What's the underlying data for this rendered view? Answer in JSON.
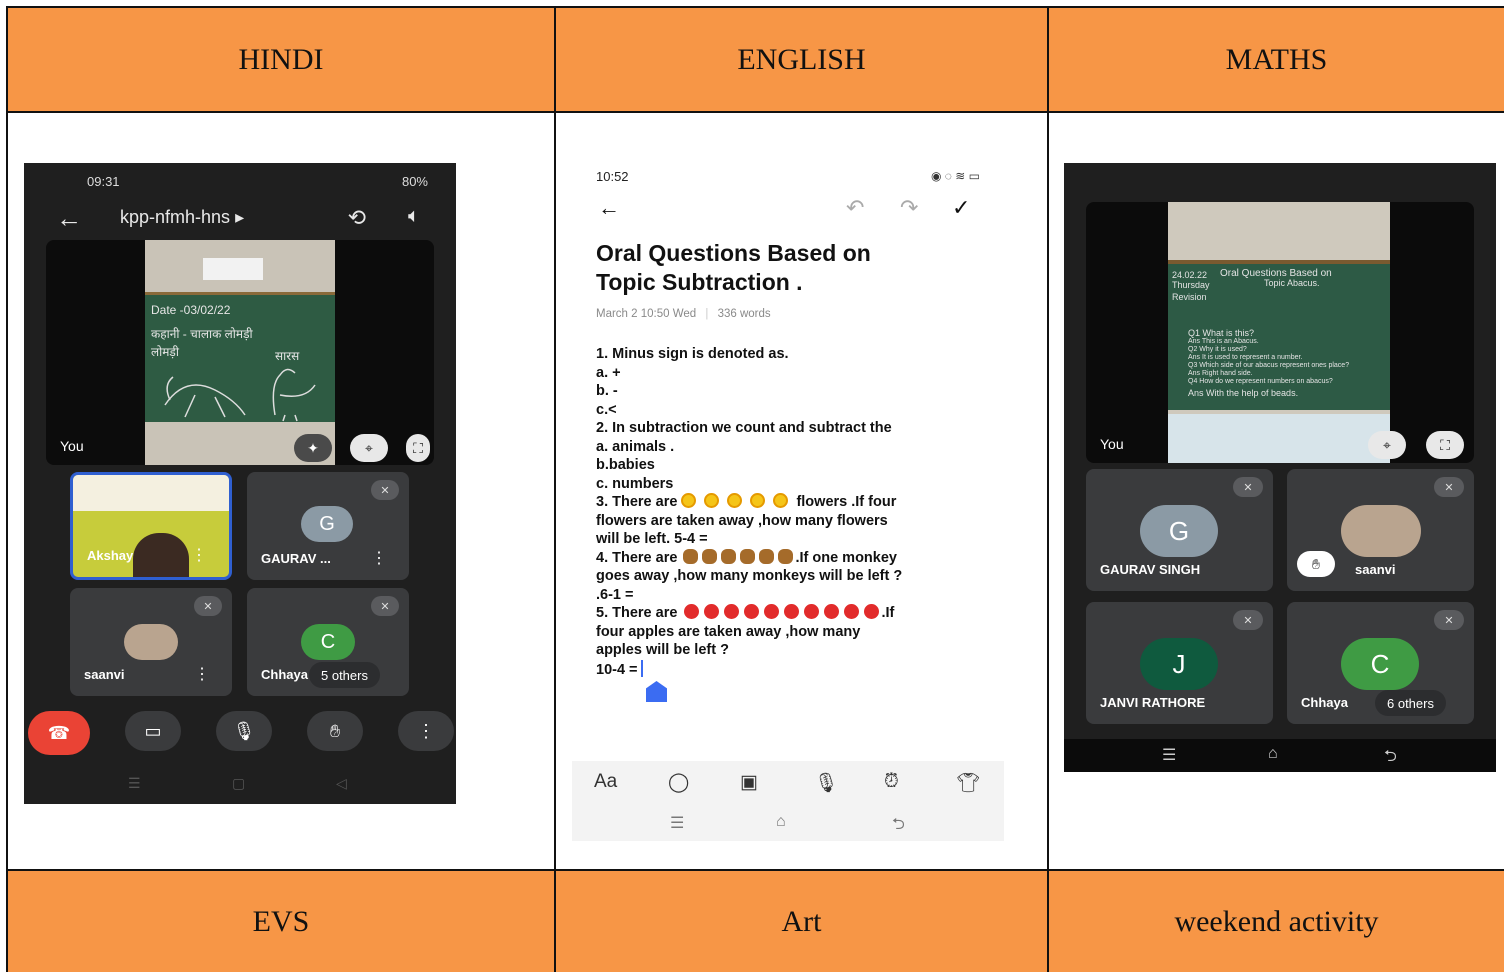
{
  "headers": [
    "HINDI",
    "ENGLISH",
    "MATHS"
  ],
  "footers": [
    "EVS",
    "Art",
    "weekend activity"
  ],
  "hindi_screen": {
    "time": "09:31",
    "status_right": "80%",
    "meeting_code": "kpp-nfmh-hns",
    "main_label": "You",
    "board_lines": [
      "Date -03/02/22",
      "कहानी - चालाक लोमड़ी",
      "लोमड़ी",
      "सारस"
    ],
    "tiles": [
      {
        "name": "Akshay",
        "avatar": ""
      },
      {
        "name": "GAURAV ...",
        "avatar": "G"
      },
      {
        "name": "saanvi",
        "avatar": ""
      },
      {
        "name": "Chhaya",
        "avatar": "C"
      }
    ],
    "others": "5 others"
  },
  "english_screen": {
    "status_left": "10:52",
    "title_line1": "Oral Questions Based on",
    "title_line2": "Topic Subtraction .",
    "date": "March 2 10:50 Wed",
    "word_count": "336 words",
    "lines": [
      "1. Minus sign is denoted as.",
      "a. +",
      "b. -",
      "c.<",
      "2. In subtraction we count and subtract the",
      "a. animals .",
      "b.babies",
      "c. numbers"
    ],
    "q3a": "3. There are",
    "q3b": "flowers .If four",
    "q3c": "flowers are taken away ,how many flowers",
    "q3d": "will be left. 5-4 =",
    "q4a": "4. There are",
    "q4b": ".If one monkey",
    "q4c": "goes away ,how many monkeys will be left ?",
    "q4d": ".6-1 =",
    "q5a": "5. There are",
    "q5b": ".If",
    "q5c": "four apples are taken away ,how many",
    "q5d": "apples will be left ?",
    "q5e": "10-4 =",
    "tool_text": "Aa"
  },
  "maths_screen": {
    "main_label": "You",
    "board_lines": [
      "24.02.22",
      "Oral Questions Based on",
      "Topic Abacus.",
      "Thursday",
      "Revision",
      "Q1 What is this?",
      "Ans This is an Abacus.",
      "Q2 Why it is used?",
      "Ans It is used to represent a number.",
      "Q3 Which side of our abacus represent ones place?",
      "Ans Right hand side.",
      "Q4 How do we represent numbers on abacus?",
      "Ans With the help of beads."
    ],
    "tiles": [
      {
        "name": "GAURAV SINGH",
        "avatar": "G"
      },
      {
        "name": "saanvi",
        "avatar": ""
      },
      {
        "name": "JANVI RATHORE",
        "avatar": "J"
      },
      {
        "name": "Chhaya",
        "avatar": "C"
      }
    ],
    "others": "6 others"
  }
}
